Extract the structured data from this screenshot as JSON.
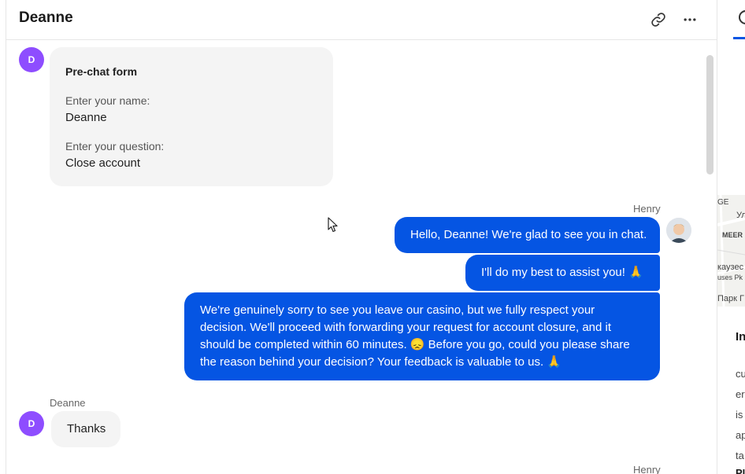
{
  "header": {
    "title": "Deanne"
  },
  "colors": {
    "accent": "#0555e3",
    "avatar_user": "#8e4dff",
    "incoming_bubble": "#f4f4f4"
  },
  "messages": {
    "prechat": {
      "avatar_letter": "D",
      "title": "Pre-chat form",
      "name_label": "Enter your name:",
      "name_value": "Deanne",
      "question_label": "Enter your question:",
      "question_value": "Close account"
    },
    "agent_group": {
      "sender": "Henry",
      "m1": "Hello, Deanne! We're glad to see you in chat.",
      "m2": "I'll do my best to assist you! 🙏",
      "m3_line1": "We're genuinely sorry to see you leave our casino, but we fully respect your",
      "m3_line2": "decision. We'll proceed with forwarding your request for account closure, and it",
      "m3_line3": "should be completed within 60 minutes. 😞 Before you go, could you please share",
      "m3_line4": "the reason behind your decision? Your feedback is valuable to us. 🙏"
    },
    "user_reply": {
      "sender": "Deanne",
      "avatar_letter": "D",
      "text": "Thanks"
    },
    "next_sender": "Henry"
  },
  "right_panel": {
    "map_labels": [
      "GE",
      "Ул",
      "MEER",
      "каузес",
      "uses Pk",
      "Парк Г"
    ],
    "heading": "In",
    "lines": [
      "cu",
      "er",
      "is",
      "ap",
      "ta",
      "PI"
    ]
  },
  "icons": {
    "link": "link-icon",
    "more": "more-horizontal-icon",
    "cursor": "mouse-cursor-icon"
  }
}
